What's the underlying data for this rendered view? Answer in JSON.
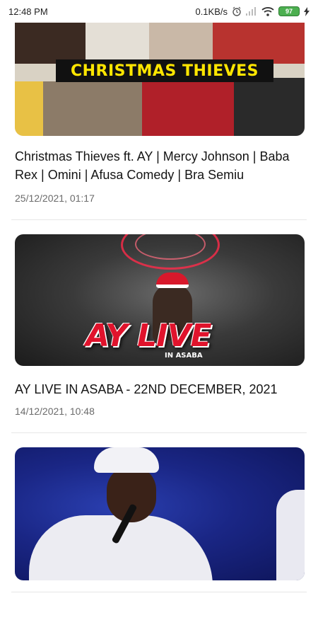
{
  "status_bar": {
    "time": "12:48 PM",
    "network_speed": "0.1KB/s",
    "battery": "97",
    "icons": [
      "alarm-icon",
      "signal-icon",
      "wifi-icon",
      "battery-icon",
      "charging-icon"
    ]
  },
  "videos": [
    {
      "thumbnail_text": "CHRISTMAS THIEVES",
      "title": "Christmas Thieves ft. AY | Mercy Johnson | Baba Rex | Omini | Afusa Comedy | Bra Semiu",
      "date": "25/12/2021, 01:17"
    },
    {
      "thumbnail_text": "AY LIVE",
      "thumbnail_subtext": "IN ASABA",
      "title": "AY LIVE IN ASABA - 22ND DECEMBER, 2021",
      "date": "14/12/2021, 10:48"
    },
    {
      "title": "",
      "date": ""
    }
  ],
  "colors": {
    "background": "#ffffff",
    "date_text": "#6b6b6b",
    "banner_text": "#ffe600",
    "battery_green": "#4caf50"
  }
}
